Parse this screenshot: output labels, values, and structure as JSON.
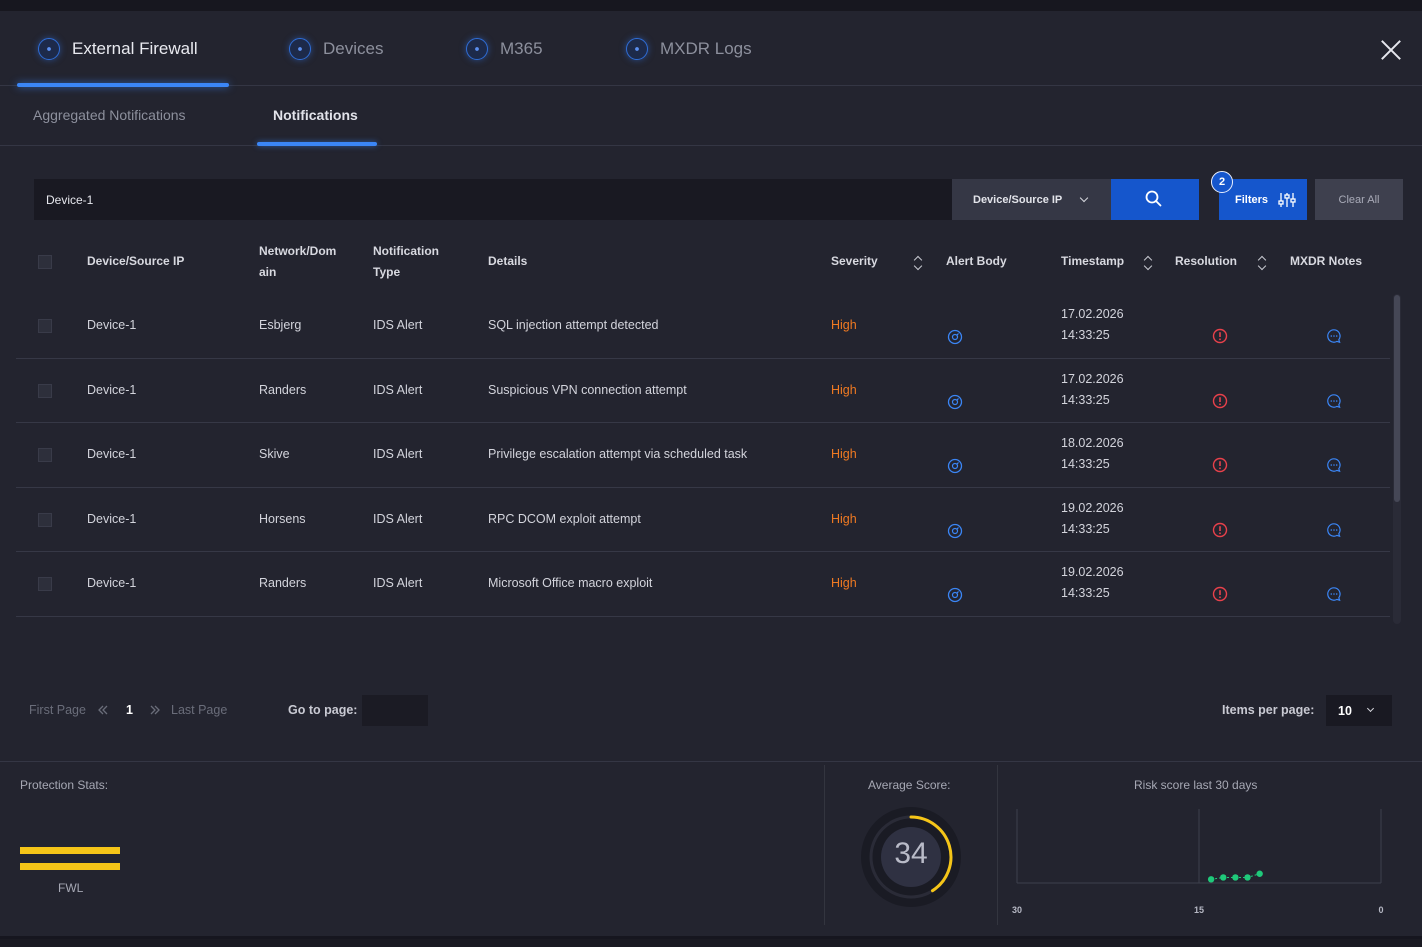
{
  "main_tabs": [
    {
      "label": "External Firewall"
    },
    {
      "label": "Devices"
    },
    {
      "label": "M365"
    },
    {
      "label": "MXDR Logs"
    }
  ],
  "sub_tabs": [
    {
      "label": "Aggregated Notifications"
    },
    {
      "label": "Notifications"
    }
  ],
  "search": {
    "value": "Device-1",
    "field": "Device/Source IP",
    "filters_label": "Filters",
    "filters_count": "2",
    "clear_label": "Clear All"
  },
  "table": {
    "headers": {
      "device": "Device/Source IP",
      "network_1": "Network/Dom",
      "network_2": "ain",
      "type_1": "Notification",
      "type_2": "Type",
      "details": "Details",
      "severity": "Severity",
      "alert_body": "Alert Body",
      "timestamp": "Timestamp",
      "resolution": "Resolution",
      "notes": "MXDR Notes"
    },
    "rows": [
      {
        "device": "Device-1",
        "network": "Esbjerg",
        "type": "IDS Alert",
        "details": "SQL injection attempt detected",
        "severity": "High",
        "date": "17.02.2026",
        "time": "14:33:25"
      },
      {
        "device": "Device-1",
        "network": "Randers",
        "type": "IDS Alert",
        "details": "Suspicious VPN connection attempt",
        "severity": "High",
        "date": "17.02.2026",
        "time": "14:33:25"
      },
      {
        "device": "Device-1",
        "network": "Skive",
        "type": "IDS Alert",
        "details": "Privilege escalation attempt via scheduled task",
        "severity": "High",
        "date": "18.02.2026",
        "time": "14:33:25"
      },
      {
        "device": "Device-1",
        "network": "Horsens",
        "type": "IDS Alert",
        "details": "RPC DCOM exploit attempt",
        "severity": "High",
        "date": "19.02.2026",
        "time": "14:33:25"
      },
      {
        "device": "Device-1",
        "network": "Randers",
        "type": "IDS Alert",
        "details": "Microsoft Office macro exploit",
        "severity": "High",
        "date": "19.02.2026",
        "time": "14:33:25"
      }
    ]
  },
  "pagination": {
    "first": "First Page",
    "current": "1",
    "last": "Last Page",
    "goto_label": "Go to page:",
    "items_label": "Items per page:",
    "items_value": "10"
  },
  "stats": {
    "protection_label": "Protection Stats:",
    "fwl_label": "FWL",
    "average_label": "Average Score:",
    "average_score": "34",
    "risk_title": "Risk score last 30 days",
    "colors": {
      "accent": "#3b86f6",
      "button": "#1556cc",
      "severity_high": "#f07a22",
      "gauge": "#f5c518",
      "points": "#1fc97a",
      "alert": "#e8414b"
    }
  },
  "chart_data": {
    "type": "scatter",
    "title": "Risk score last 30 days",
    "x_tick_labels": [
      "30",
      "15",
      "0"
    ],
    "xlim": [
      30,
      0
    ],
    "x": [
      14,
      13,
      12,
      11,
      10
    ],
    "y": [
      1,
      1.5,
      1.5,
      1.5,
      2.5
    ],
    "ylim": [
      0,
      20
    ],
    "point_color": "#1fc97a"
  }
}
